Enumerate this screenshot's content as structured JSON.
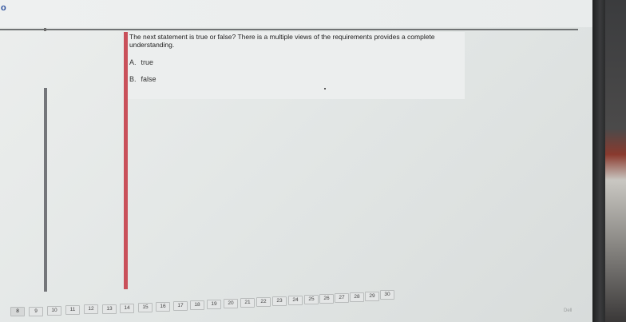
{
  "corner_label": "o",
  "question": {
    "text": "The next statement is true or false? There is a multiple views of the requirements provides a complete understanding.",
    "options": [
      {
        "letter": "A.",
        "label": "true"
      },
      {
        "letter": "B.",
        "label": "false"
      }
    ]
  },
  "pager": {
    "pages": [
      "8",
      "9",
      "10",
      "11",
      "12",
      "13",
      "14",
      "15",
      "16",
      "17",
      "18",
      "19",
      "20",
      "21",
      "22",
      "23",
      "24",
      "25",
      "26",
      "27",
      "28",
      "29",
      "30"
    ],
    "current": "8"
  },
  "footer_mark": "Dell"
}
